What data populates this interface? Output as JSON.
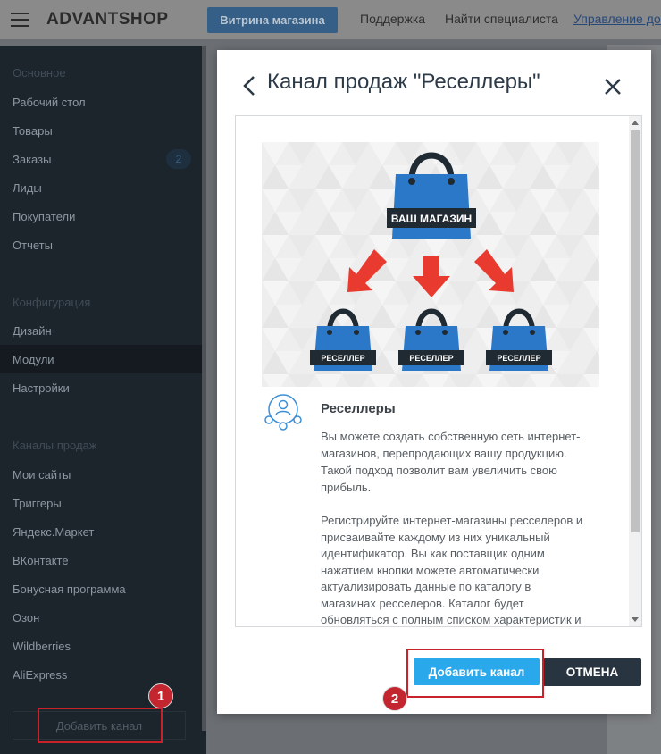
{
  "topbar": {
    "brand": "ADVANTSHOP",
    "store_button": "Витрина магазина",
    "support": "Поддержка",
    "find_specialist": "Найти специалиста",
    "manage_link": "Управление домен"
  },
  "sidebar": {
    "sections": [
      {
        "title": "Основное",
        "items": [
          "Рабочий стол",
          "Товары",
          "Заказы",
          "Лиды",
          "Покупатели",
          "Отчеты"
        ]
      },
      {
        "title": "Конфигурация",
        "items": [
          "Дизайн",
          "Модули",
          "Настройки"
        ]
      },
      {
        "title": "Каналы продаж",
        "items": [
          "Мои сайты",
          "Триггеры",
          "Яндекс.Маркет",
          "ВКонтакте",
          "Бонусная программа",
          "Озон",
          "Wildberries",
          "AliExpress"
        ]
      }
    ],
    "orders_badge": "2",
    "add_channel": "Добавить канал",
    "marker1": "1"
  },
  "modal": {
    "title": "Канал продаж \"Реселлеры\"",
    "banner": {
      "shop_label": "ВАШ МАГАЗИН",
      "reseller_label": "РЕСЕЛЛЕР"
    },
    "section_title": "Реселлеры",
    "paragraph1": [
      "Вы можете создать собственную сеть интернет-",
      "магазинов, перепродающих вашу продукцию.",
      "Такой подход позволит вам увеличить свою",
      "прибыль."
    ],
    "paragraph2": [
      "Регистрируйте интернет-магазины ресселеров и",
      "присваивайте каждому из них уникальный",
      "идентификатор. Вы как поставщик одним",
      "нажатием кнопки можете автоматически",
      "актуализировать данные по каталогу в",
      "магазинах ресселеров. Каталог будет",
      "обновляться с полным списком характеристик и"
    ],
    "add_button": "Добавить канал",
    "cancel_button": "ОТМЕНА",
    "marker2": "2"
  },
  "colors": {
    "accent": "#2aa8ec",
    "dark_button": "#293441",
    "highlight": "#c8222b",
    "bag_blue": "#2b78c8",
    "arrow_red": "#e83a2f"
  }
}
